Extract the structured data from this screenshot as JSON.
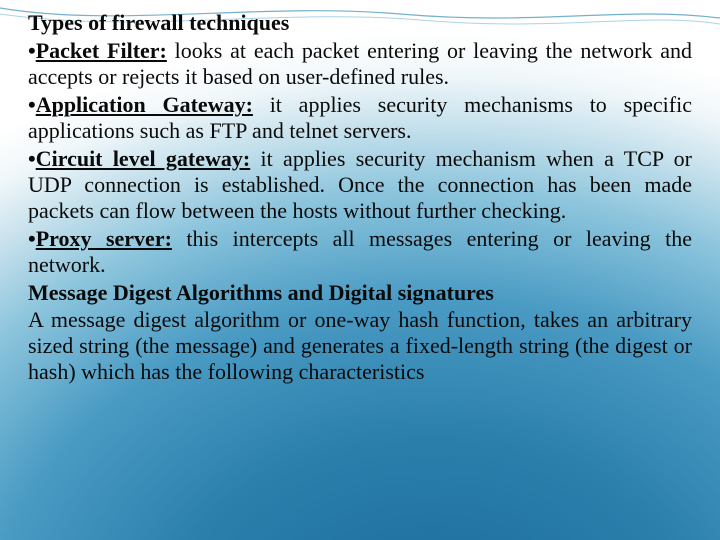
{
  "title": "Types of firewall techniques",
  "bullets": [
    {
      "lead": "Packet Filter:",
      "body": " looks at each packet entering or leaving the network and accepts or rejects it based on user-defined rules."
    },
    {
      "lead": "Application Gateway:",
      "body": " it applies security mechanisms to specific applications such as FTP and telnet servers."
    },
    {
      "lead": "Circuit level gateway:",
      "body": " it applies security mechanism when a TCP or UDP connection is established. Once the connection has been made packets can flow between the hosts without further checking."
    },
    {
      "lead": "Proxy server:",
      "body": " this intercepts all messages entering or leaving the network."
    }
  ],
  "subhead": "Message Digest Algorithms and Digital signatures",
  "paragraph": "A message digest algorithm or one-way hash function, takes an arbitrary sized string (the message) and generates a fixed-length string (the digest or hash) which has the following characteristics"
}
